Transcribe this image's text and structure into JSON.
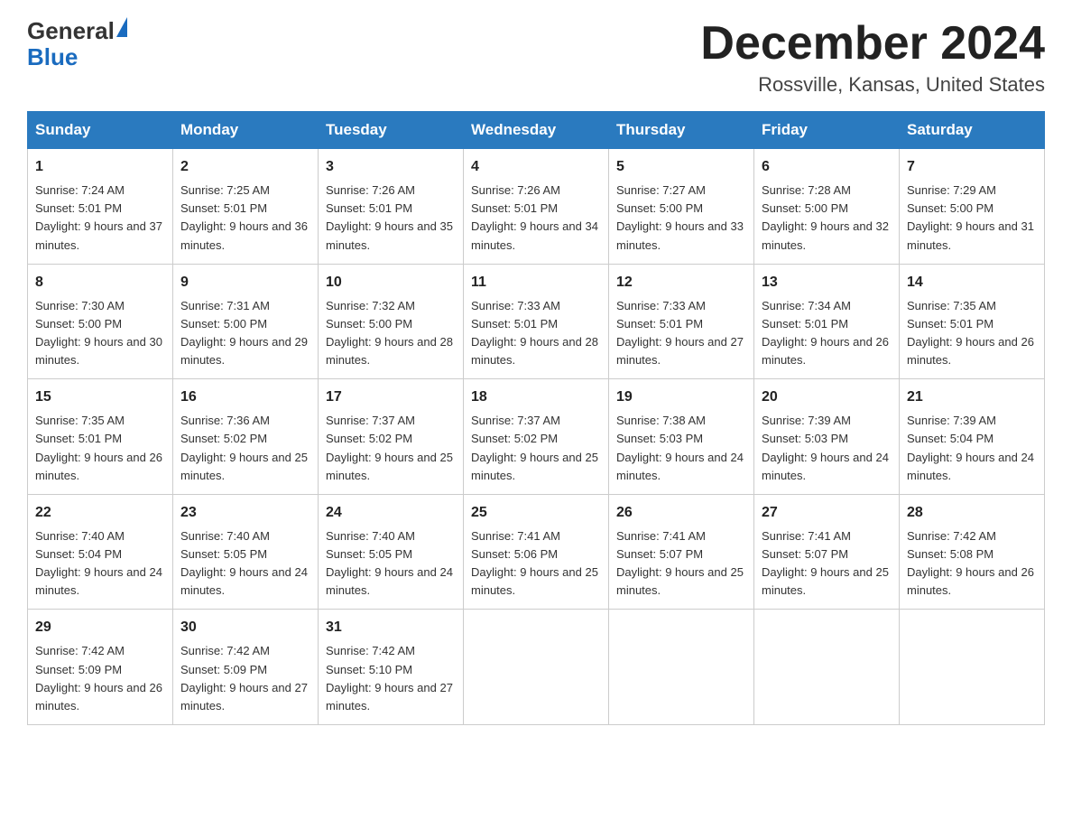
{
  "logo": {
    "general": "General",
    "blue": "Blue"
  },
  "title": "December 2024",
  "location": "Rossville, Kansas, United States",
  "days_of_week": [
    "Sunday",
    "Monday",
    "Tuesday",
    "Wednesday",
    "Thursday",
    "Friday",
    "Saturday"
  ],
  "weeks": [
    [
      {
        "day": "1",
        "sunrise": "7:24 AM",
        "sunset": "5:01 PM",
        "daylight": "9 hours and 37 minutes."
      },
      {
        "day": "2",
        "sunrise": "7:25 AM",
        "sunset": "5:01 PM",
        "daylight": "9 hours and 36 minutes."
      },
      {
        "day": "3",
        "sunrise": "7:26 AM",
        "sunset": "5:01 PM",
        "daylight": "9 hours and 35 minutes."
      },
      {
        "day": "4",
        "sunrise": "7:26 AM",
        "sunset": "5:01 PM",
        "daylight": "9 hours and 34 minutes."
      },
      {
        "day": "5",
        "sunrise": "7:27 AM",
        "sunset": "5:00 PM",
        "daylight": "9 hours and 33 minutes."
      },
      {
        "day": "6",
        "sunrise": "7:28 AM",
        "sunset": "5:00 PM",
        "daylight": "9 hours and 32 minutes."
      },
      {
        "day": "7",
        "sunrise": "7:29 AM",
        "sunset": "5:00 PM",
        "daylight": "9 hours and 31 minutes."
      }
    ],
    [
      {
        "day": "8",
        "sunrise": "7:30 AM",
        "sunset": "5:00 PM",
        "daylight": "9 hours and 30 minutes."
      },
      {
        "day": "9",
        "sunrise": "7:31 AM",
        "sunset": "5:00 PM",
        "daylight": "9 hours and 29 minutes."
      },
      {
        "day": "10",
        "sunrise": "7:32 AM",
        "sunset": "5:00 PM",
        "daylight": "9 hours and 28 minutes."
      },
      {
        "day": "11",
        "sunrise": "7:33 AM",
        "sunset": "5:01 PM",
        "daylight": "9 hours and 28 minutes."
      },
      {
        "day": "12",
        "sunrise": "7:33 AM",
        "sunset": "5:01 PM",
        "daylight": "9 hours and 27 minutes."
      },
      {
        "day": "13",
        "sunrise": "7:34 AM",
        "sunset": "5:01 PM",
        "daylight": "9 hours and 26 minutes."
      },
      {
        "day": "14",
        "sunrise": "7:35 AM",
        "sunset": "5:01 PM",
        "daylight": "9 hours and 26 minutes."
      }
    ],
    [
      {
        "day": "15",
        "sunrise": "7:35 AM",
        "sunset": "5:01 PM",
        "daylight": "9 hours and 26 minutes."
      },
      {
        "day": "16",
        "sunrise": "7:36 AM",
        "sunset": "5:02 PM",
        "daylight": "9 hours and 25 minutes."
      },
      {
        "day": "17",
        "sunrise": "7:37 AM",
        "sunset": "5:02 PM",
        "daylight": "9 hours and 25 minutes."
      },
      {
        "day": "18",
        "sunrise": "7:37 AM",
        "sunset": "5:02 PM",
        "daylight": "9 hours and 25 minutes."
      },
      {
        "day": "19",
        "sunrise": "7:38 AM",
        "sunset": "5:03 PM",
        "daylight": "9 hours and 24 minutes."
      },
      {
        "day": "20",
        "sunrise": "7:39 AM",
        "sunset": "5:03 PM",
        "daylight": "9 hours and 24 minutes."
      },
      {
        "day": "21",
        "sunrise": "7:39 AM",
        "sunset": "5:04 PM",
        "daylight": "9 hours and 24 minutes."
      }
    ],
    [
      {
        "day": "22",
        "sunrise": "7:40 AM",
        "sunset": "5:04 PM",
        "daylight": "9 hours and 24 minutes."
      },
      {
        "day": "23",
        "sunrise": "7:40 AM",
        "sunset": "5:05 PM",
        "daylight": "9 hours and 24 minutes."
      },
      {
        "day": "24",
        "sunrise": "7:40 AM",
        "sunset": "5:05 PM",
        "daylight": "9 hours and 24 minutes."
      },
      {
        "day": "25",
        "sunrise": "7:41 AM",
        "sunset": "5:06 PM",
        "daylight": "9 hours and 25 minutes."
      },
      {
        "day": "26",
        "sunrise": "7:41 AM",
        "sunset": "5:07 PM",
        "daylight": "9 hours and 25 minutes."
      },
      {
        "day": "27",
        "sunrise": "7:41 AM",
        "sunset": "5:07 PM",
        "daylight": "9 hours and 25 minutes."
      },
      {
        "day": "28",
        "sunrise": "7:42 AM",
        "sunset": "5:08 PM",
        "daylight": "9 hours and 26 minutes."
      }
    ],
    [
      {
        "day": "29",
        "sunrise": "7:42 AM",
        "sunset": "5:09 PM",
        "daylight": "9 hours and 26 minutes."
      },
      {
        "day": "30",
        "sunrise": "7:42 AM",
        "sunset": "5:09 PM",
        "daylight": "9 hours and 27 minutes."
      },
      {
        "day": "31",
        "sunrise": "7:42 AM",
        "sunset": "5:10 PM",
        "daylight": "9 hours and 27 minutes."
      },
      null,
      null,
      null,
      null
    ]
  ]
}
